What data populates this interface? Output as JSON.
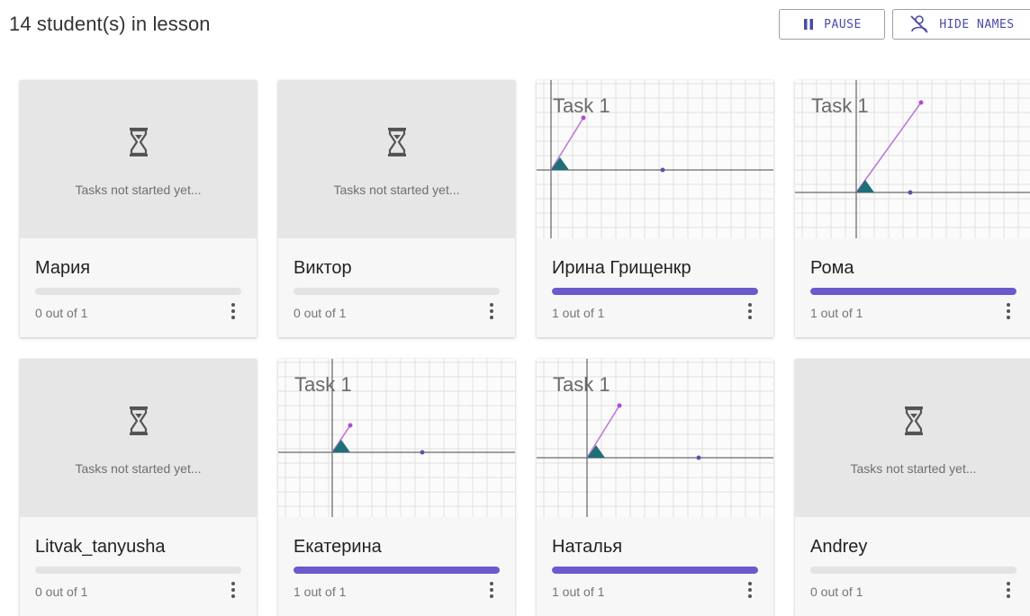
{
  "header": {
    "students_count": "14 student(s) in lesson",
    "pause_label": "PAUSE",
    "hide_names_label": "HIDE NAMES"
  },
  "task_label": "Task 1",
  "waiting_text": "Tasks not started yet...",
  "colors": {
    "accent": "#6a5acd",
    "button_text": "#4a4aa8"
  },
  "students": [
    {
      "name": "Мария",
      "progress_text": "0 out of 1",
      "progress": 0,
      "started": false
    },
    {
      "name": "Виктор",
      "progress_text": "0 out of 1",
      "progress": 0,
      "started": false
    },
    {
      "name": "Ирина Грищенкр",
      "progress_text": "1 out of 1",
      "progress": 1,
      "started": true
    },
    {
      "name": "Рома",
      "progress_text": "1 out of 1",
      "progress": 1,
      "started": true
    },
    {
      "name": "Litvak_tanyusha",
      "progress_text": "0 out of 1",
      "progress": 0,
      "started": false
    },
    {
      "name": "Екатерина",
      "progress_text": "1 out of 1",
      "progress": 1,
      "started": true
    },
    {
      "name": "Наталья",
      "progress_text": "1 out of 1",
      "progress": 1,
      "started": true
    },
    {
      "name": "Andrey",
      "progress_text": "0 out of 1",
      "progress": 0,
      "started": false
    }
  ]
}
